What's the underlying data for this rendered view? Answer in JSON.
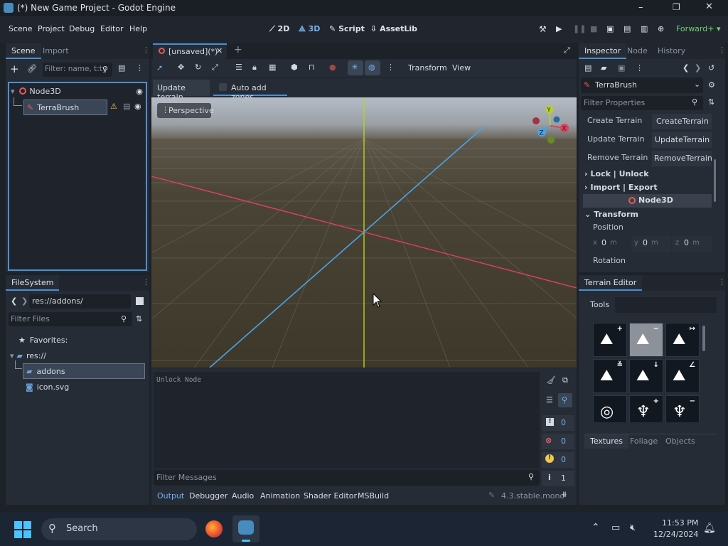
{
  "window": {
    "title": "(*) New Game Project - Godot Engine",
    "controls": [
      "–",
      "❐",
      "✕"
    ]
  },
  "menu": {
    "items": [
      "Scene",
      "Project",
      "Debug",
      "Editor",
      "Help"
    ],
    "workspaces": [
      {
        "label": "2D",
        "icon": "2d-icon"
      },
      {
        "label": "3D",
        "icon": "3d-icon",
        "active": true
      },
      {
        "label": "Script",
        "icon": "script-icon"
      },
      {
        "label": "AssetLib",
        "icon": "assetlib-icon"
      }
    ],
    "renderer": "Forward+"
  },
  "scene_dock": {
    "tabs": [
      "Scene",
      "Import"
    ],
    "filter_placeholder": "Filter: name, t:ty",
    "tree": [
      {
        "label": "Node3D",
        "icon": "node3d-icon"
      },
      {
        "label": "TerraBrush",
        "icon": "terrabrush-icon",
        "selected": true,
        "warning": true
      }
    ]
  },
  "filesystem": {
    "title": "FileSystem",
    "path": "res://addons/",
    "filter_placeholder": "Filter Files",
    "items": [
      {
        "label": "Favorites:",
        "icon": "star-icon"
      },
      {
        "label": "res://",
        "icon": "folder-icon"
      },
      {
        "label": "addons",
        "icon": "folder-icon",
        "selected": true
      },
      {
        "label": "icon.svg",
        "icon": "godot-icon"
      }
    ]
  },
  "editor_tabs": {
    "current": "[unsaved](*)"
  },
  "toolbar3d": {
    "transform": "Transform",
    "view": "View"
  },
  "terrain_bar": {
    "update": "Update terrain",
    "auto_add": "Auto add zones"
  },
  "viewport": {
    "perspective": "Perspective",
    "gizmo": {
      "x": "X",
      "y": "Y",
      "z": "Z"
    }
  },
  "output": {
    "log": "Unlock Node",
    "filter_placeholder": "Filter Messages",
    "counts": {
      "log": "0",
      "errors": "0",
      "warnings": "0",
      "info": "1"
    },
    "tabs": [
      "Output",
      "Debugger",
      "Audio",
      "Animation",
      "Shader Editor",
      "MSBuild"
    ],
    "version": "4.3.stable.mono"
  },
  "inspector": {
    "tabs": [
      "Inspector",
      "Node",
      "History"
    ],
    "object": "TerraBrush",
    "filter_placeholder": "Filter Properties",
    "props": [
      {
        "label": "Create Terrain",
        "value": "CreateTerrain"
      },
      {
        "label": "Update Terrain",
        "value": "UpdateTerrain"
      },
      {
        "label": "Remove Terrain",
        "value": "RemoveTerrain"
      }
    ],
    "groups": [
      "Lock | Unlock",
      "Import | Export"
    ],
    "node_section": "Node3D",
    "transform": "Transform",
    "position": "Position",
    "rotation": "Rotation",
    "pos": {
      "x": "0",
      "y": "0",
      "z": "0",
      "unit": "m"
    }
  },
  "terrain_editor": {
    "title": "Terrain Editor",
    "tools_tab": "Tools",
    "tabs": [
      "Textures",
      "Foliage",
      "Objects"
    ],
    "tools": [
      {
        "icon": "raise-terrain-icon",
        "badge": "+"
      },
      {
        "icon": "lower-terrain-icon",
        "badge": "−",
        "selected": true
      },
      {
        "icon": "flatten-terrain-icon",
        "badge": "↦"
      },
      {
        "icon": "smooth-terrain-icon",
        "badge": "≚"
      },
      {
        "icon": "set-height-icon",
        "badge": "↓"
      },
      {
        "icon": "set-angle-icon",
        "badge": "∠"
      },
      {
        "icon": "paint-texture-icon",
        "badge": ""
      },
      {
        "icon": "add-foliage-icon",
        "badge": "+"
      },
      {
        "icon": "remove-foliage-icon",
        "badge": "−"
      }
    ]
  },
  "taskbar": {
    "search": "Search",
    "time": "11:53 PM",
    "date": "12/24/2024"
  }
}
